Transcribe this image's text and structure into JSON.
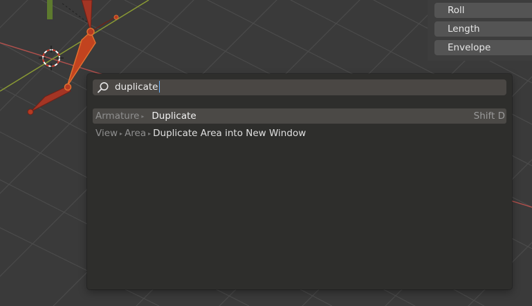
{
  "side_panel": {
    "buttons": [
      "Roll",
      "Length",
      "Envelope"
    ]
  },
  "search": {
    "query": "duplicate",
    "results": [
      {
        "path": [
          "Armature"
        ],
        "label": "Duplicate",
        "shortcut": "Shift D",
        "highlighted": true
      },
      {
        "path": [
          "View",
          "Area"
        ],
        "label": "Duplicate Area into New Window",
        "shortcut": "",
        "highlighted": false
      }
    ]
  },
  "colors": {
    "viewport_bg": "#3a3a3a",
    "grid_line": "#4c4c4c",
    "x_axis": "#b0504c",
    "y_axis": "#8a9a34",
    "bone_fill": "#a43524",
    "bone_selected": "#e07030",
    "popup_bg": "#2e2e2c",
    "highlight_row": "#4b4946",
    "text_cursor": "#6fb6ff"
  }
}
